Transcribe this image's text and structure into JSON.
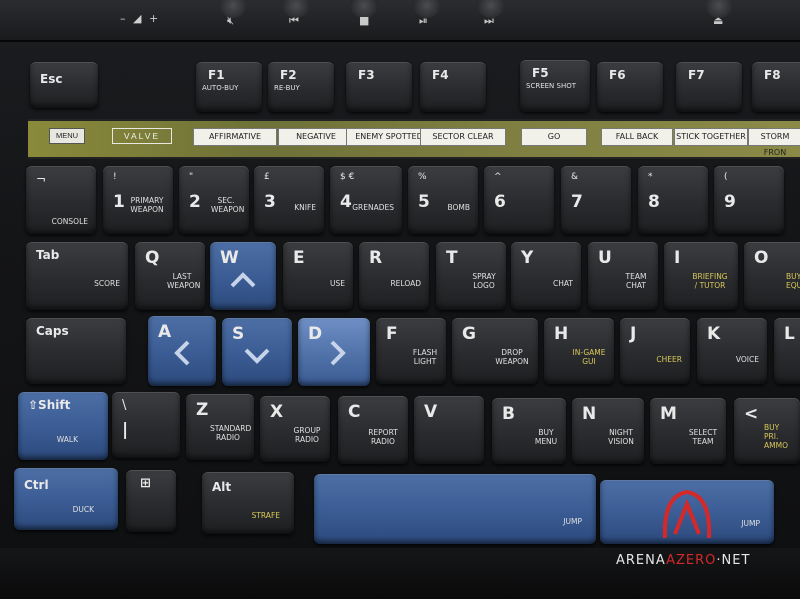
{
  "scene": {
    "colors": {
      "body": "#141517",
      "key_dark": "#2a2b2e",
      "key_blue": "#3a5b93",
      "panel": "#7d7e40",
      "accent_red": "#d52828"
    }
  },
  "media_row": {
    "volume_label": "– ◢ +",
    "icons": [
      "mute-icon",
      "previous-track-icon",
      "stop-icon",
      "play-pause-icon",
      "next-track-icon",
      "eject-icon"
    ]
  },
  "panel": {
    "menu": "MENU",
    "brand": "VALVE",
    "labels": [
      "AFFIRMATIVE",
      "NEGATIVE",
      "ENEMY SPOTTED",
      "SECTOR CLEAR",
      "GO",
      "FALL BACK",
      "STICK TOGETHER",
      "STORM FRON"
    ]
  },
  "keys": {
    "esc": "Esc",
    "f1": {
      "main": "F1",
      "act": "AUTO-BUY"
    },
    "f2": {
      "main": "F2",
      "act": "RE-BUY"
    },
    "f3": {
      "main": "F3",
      "act": ""
    },
    "f4": {
      "main": "F4",
      "act": ""
    },
    "f5": {
      "main": "F5",
      "act": "SCREEN SHOT"
    },
    "f6": {
      "main": "F6",
      "act": ""
    },
    "f7": {
      "main": "F7",
      "act": ""
    },
    "f8": {
      "main": "F8",
      "act": ""
    },
    "tilde": {
      "sub": "¬",
      "act": "CONSOLE"
    },
    "k1": {
      "sub": "!",
      "main": "1",
      "act": "PRIMARY WEAPON"
    },
    "k2": {
      "sub": "\"",
      "main": "2",
      "act": "SEC. WEAPON"
    },
    "k3": {
      "sub": "£",
      "main": "3",
      "act": "KNIFE"
    },
    "k4": {
      "sub": "$ €",
      "main": "4",
      "act": "GRENADES"
    },
    "k5": {
      "sub": "%",
      "main": "5",
      "act": "BOMB"
    },
    "k6": {
      "sub": "^",
      "main": "6",
      "act": ""
    },
    "k7": {
      "sub": "&",
      "main": "7",
      "act": ""
    },
    "k8": {
      "sub": "*",
      "main": "8",
      "act": ""
    },
    "k9": {
      "sub": "(",
      "main": "9",
      "act": ""
    },
    "tab": {
      "main": "Tab",
      "act": "SCORE"
    },
    "q": {
      "main": "Q",
      "act": "LAST WEAPON"
    },
    "w": {
      "main": "W",
      "act": ""
    },
    "e": {
      "main": "E",
      "act": "USE"
    },
    "r": {
      "main": "R",
      "act": "RELOAD"
    },
    "t": {
      "main": "T",
      "act": "SPRAY LOGO"
    },
    "y": {
      "main": "Y",
      "act": "CHAT"
    },
    "u": {
      "main": "U",
      "act": "TEAM CHAT"
    },
    "i": {
      "main": "I",
      "act": "BRIEFING / TUTOR"
    },
    "o": {
      "main": "O",
      "act": "BUY EQUIP"
    },
    "caps": {
      "main": "Caps"
    },
    "a": {
      "main": "A"
    },
    "s": {
      "main": "S"
    },
    "d": {
      "main": "D"
    },
    "f": {
      "main": "F",
      "act": "FLASH LIGHT"
    },
    "g": {
      "main": "G",
      "act": "DROP WEAPON"
    },
    "h": {
      "main": "H",
      "act": "IN-GAME GUI"
    },
    "j": {
      "main": "J",
      "act": "CHEER"
    },
    "k": {
      "main": "K",
      "act": "VOICE"
    },
    "l": {
      "main": "L"
    },
    "shift": {
      "main": "⇧Shift",
      "act": "WALK"
    },
    "backslash": {
      "sub": "\\",
      "main": "|"
    },
    "z": {
      "main": "Z",
      "act": "STANDARD RADIO"
    },
    "x": {
      "main": "X",
      "act": "GROUP RADIO"
    },
    "c": {
      "main": "C",
      "act": "REPORT RADIO"
    },
    "v": {
      "main": "V"
    },
    "b": {
      "main": "B",
      "act": "BUY MENU"
    },
    "n": {
      "main": "N",
      "act": "NIGHT VISION"
    },
    "m": {
      "main": "M",
      "act": "SELECT TEAM"
    },
    "comma": {
      "main": "<",
      "act": "BUY PRI. AMMO"
    },
    "ctrl": {
      "main": "Ctrl",
      "act": "DUCK"
    },
    "win": {
      "main": "⊞"
    },
    "alt": {
      "main": "Alt",
      "act": "STRAFE"
    },
    "space_left": {
      "act": "JUMP"
    },
    "space_right": {
      "act": "JUMP"
    }
  },
  "watermark": {
    "prefix": "ARENA",
    "accent": "AZERO",
    "suffix": "NET"
  }
}
